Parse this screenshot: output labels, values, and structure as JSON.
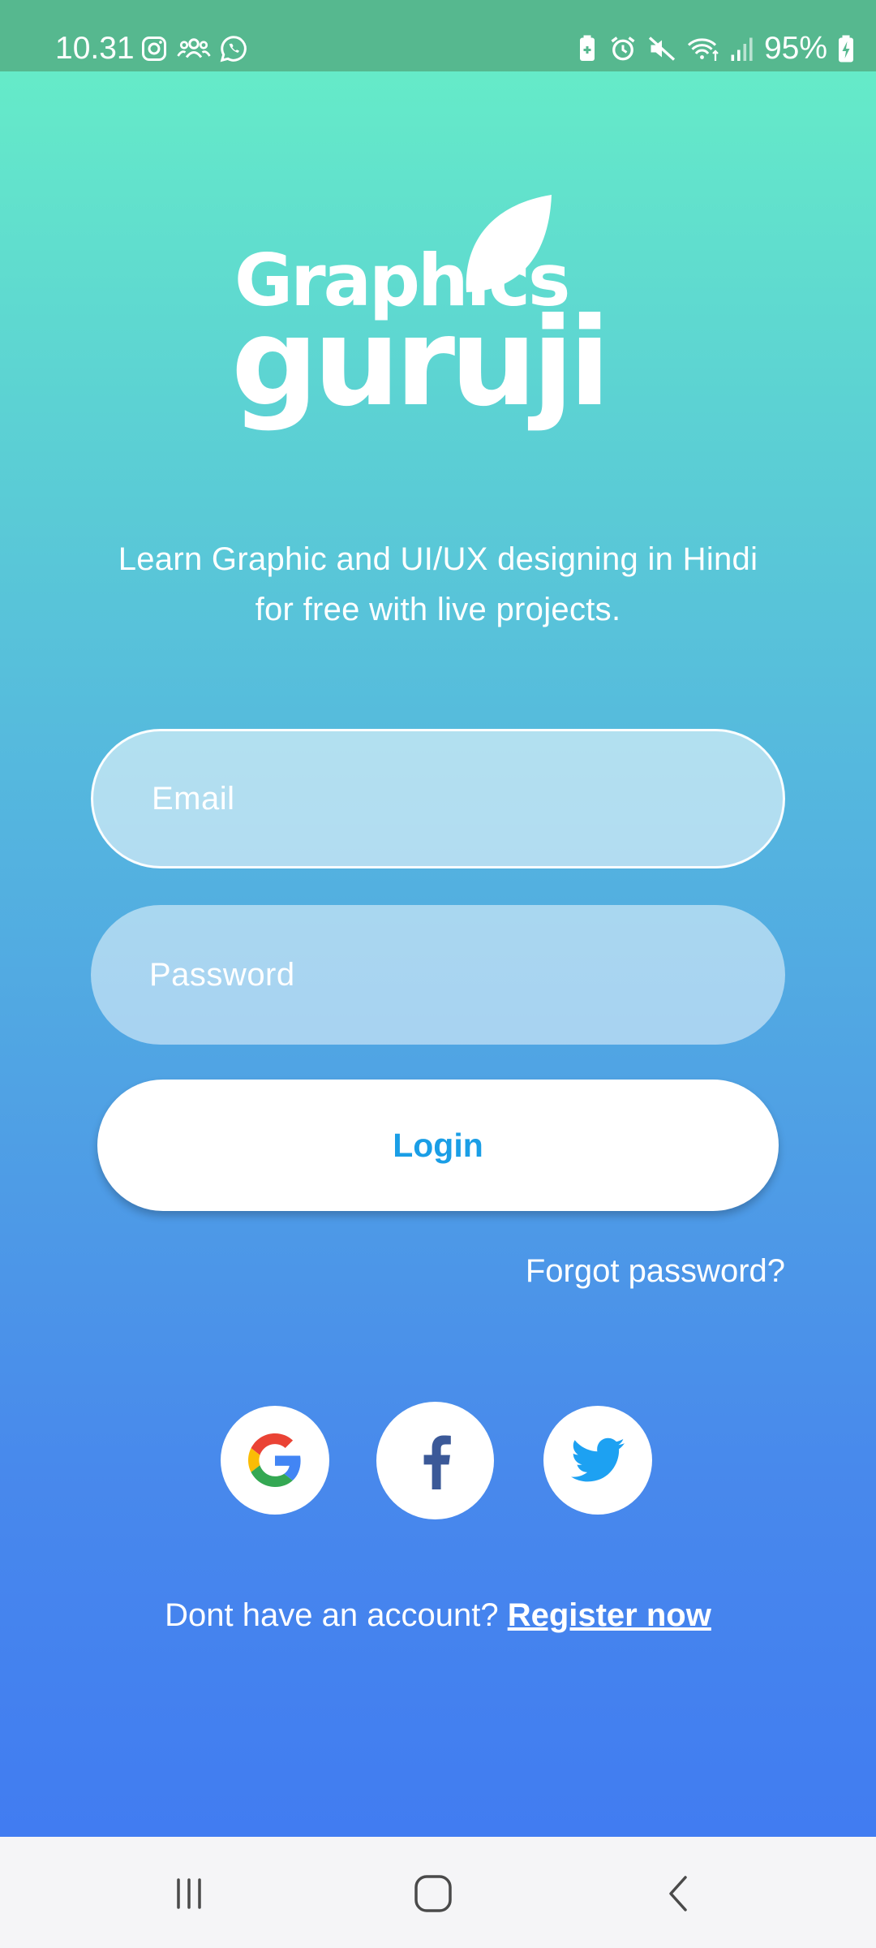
{
  "status_bar": {
    "time": "10.31",
    "battery": "95%",
    "left_icons": [
      "instagram-icon",
      "group-icon",
      "whatsapp-icon"
    ],
    "right_icons": [
      "battery-saver-icon",
      "alarm-icon",
      "mute-icon",
      "wifi-icon",
      "signal-icon",
      "battery-charging-icon"
    ]
  },
  "logo": {
    "line1": "Graphics",
    "line2": "guruji"
  },
  "tagline": {
    "line1": "Learn Graphic and UI/UX designing in Hindi",
    "line2": "for free with live projects."
  },
  "form": {
    "email_placeholder": "Email",
    "password_placeholder": "Password",
    "login_label": "Login",
    "forgot_label": "Forgot password?"
  },
  "social": [
    {
      "name": "google",
      "icon": "google-icon"
    },
    {
      "name": "facebook",
      "icon": "facebook-icon"
    },
    {
      "name": "twitter",
      "icon": "twitter-icon"
    }
  ],
  "register": {
    "prompt": "Dont have an account? ",
    "link": "Register now"
  },
  "colors": {
    "gradient_top": "#67f0c6",
    "gradient_bottom": "#417cf1",
    "status_bar": "#56b88f",
    "login_text": "#1a9ee6",
    "facebook": "#3b5998",
    "twitter": "#1da1f2"
  },
  "nav": {
    "buttons": [
      "recents-icon",
      "home-icon",
      "back-icon"
    ]
  }
}
